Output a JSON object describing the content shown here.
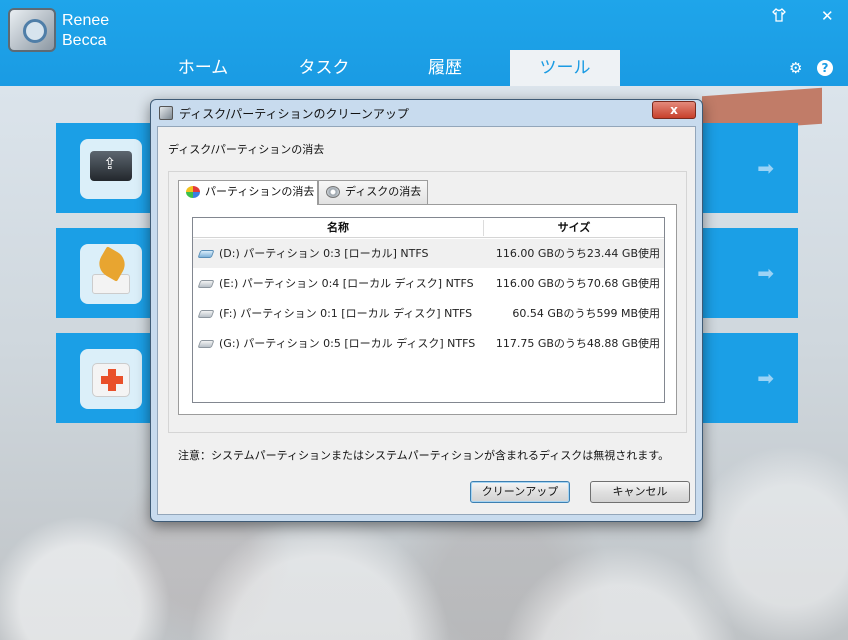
{
  "app": {
    "brand_line1": "Renee",
    "brand_line2": "Becca",
    "shirt_icon": "tshirt-icon",
    "close_label": "✕",
    "gear_label": "⚙",
    "help_label": "?"
  },
  "nav": {
    "tabs": [
      {
        "label": "ホーム"
      },
      {
        "label": "タスク"
      },
      {
        "label": "履歴"
      },
      {
        "label": "ツール"
      }
    ],
    "active_tab": "ツール"
  },
  "tiles": [
    {
      "icon": "usb-drive-icon",
      "arrow": "➡"
    },
    {
      "icon": "broom-icon",
      "arrow": "➡"
    },
    {
      "icon": "first-aid-icon",
      "arrow": "➡"
    }
  ],
  "dialog": {
    "title": "ディスク/パーティションのクリーンアップ",
    "close_label": "x",
    "subhead": "ディスク/パーティションの消去",
    "tabs": [
      {
        "label": "パーティションの消去",
        "icon": "pie-chart-icon"
      },
      {
        "label": "ディスクの消去",
        "icon": "disk-icon"
      }
    ],
    "columns": {
      "name": "名称",
      "size": "サイズ"
    },
    "rows": [
      {
        "name": "(D:) パーティション 0:3 [ローカル]   NTFS",
        "size": "116.00 GBのうち23.44 GB使用"
      },
      {
        "name": "(E:) パーティション 0:4 [ローカル ディスク]   NTFS",
        "size": "116.00 GBのうち70.68 GB使用"
      },
      {
        "name": "(F:) パーティション 0:1 [ローカル ディスク]   NTFS",
        "size": "60.54 GBのうち599 MB使用"
      },
      {
        "name": "(G:) パーティション 0:5 [ローカル ディスク]   NTFS",
        "size": "117.75 GBのうち48.88 GB使用"
      }
    ],
    "note": "注意：システムパーティションまたはシステムパーティションが含まれるディスクは無視されます。",
    "buttons": {
      "cleanup": "クリーンアップ",
      "cancel": "キャンセル"
    }
  },
  "colors": {
    "header_blue": "#1a9be3",
    "tile_blue": "#1b9fe6",
    "close_red": "#c7402c"
  }
}
